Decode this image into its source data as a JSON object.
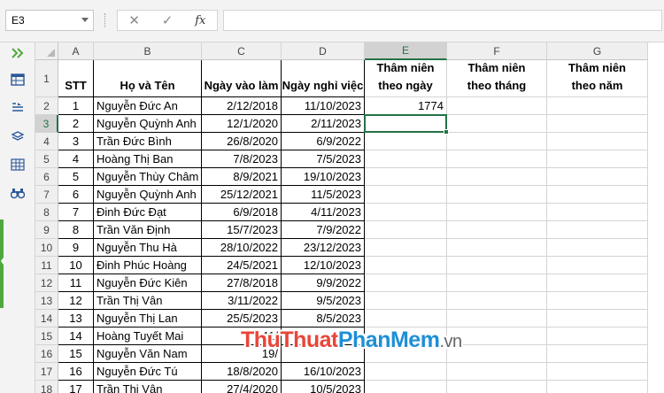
{
  "formula_bar": {
    "name_box": "E3",
    "cancel_glyph": "✕",
    "enter_glyph": "✓",
    "fx_label": "fx",
    "formula": ""
  },
  "sidebar": {
    "icons": [
      "expand-icon",
      "table-icon",
      "list-icon",
      "layers-icon",
      "grid-icon",
      "binoculars-icon"
    ]
  },
  "columns": [
    "A",
    "B",
    "C",
    "D",
    "E",
    "F",
    "G"
  ],
  "selected_column": "E",
  "selected_cell": "E3",
  "headers": {
    "stt": "STT",
    "name": "Họ và Tên",
    "start": "Ngày vào làm",
    "end": "Ngày nghỉ việc",
    "days_l1": "Thâm niên",
    "days_l2": "theo ngày",
    "months_l1": "Thâm niên",
    "months_l2": "theo tháng",
    "years_l1": "Thâm niên",
    "years_l2": "theo năm"
  },
  "row_numbers": [
    "1",
    "2",
    "3",
    "4",
    "5",
    "6",
    "7",
    "8",
    "9",
    "10",
    "11",
    "12",
    "13",
    "14",
    "15",
    "16",
    "17",
    "18"
  ],
  "rows": [
    {
      "stt": "1",
      "name": "Nguyễn Đức An",
      "start": "2/12/2018",
      "end": "11/10/2023",
      "days": "1774"
    },
    {
      "stt": "2",
      "name": "Nguyễn Quỳnh Anh",
      "start": "12/1/2020",
      "end": "2/11/2023",
      "days": ""
    },
    {
      "stt": "3",
      "name": "Trần Đức Bình",
      "start": "26/8/2020",
      "end": "6/9/2022",
      "days": ""
    },
    {
      "stt": "4",
      "name": "Hoàng Thị Ban",
      "start": "7/8/2023",
      "end": "7/5/2023",
      "days": ""
    },
    {
      "stt": "5",
      "name": "Nguyễn Thùy Châm",
      "start": "8/9/2021",
      "end": "19/10/2023",
      "days": ""
    },
    {
      "stt": "6",
      "name": "Nguyễn Quỳnh Anh",
      "start": "25/12/2021",
      "end": "11/5/2023",
      "days": ""
    },
    {
      "stt": "7",
      "name": "Đinh Đức Đạt",
      "start": "6/9/2018",
      "end": "4/11/2023",
      "days": ""
    },
    {
      "stt": "8",
      "name": "Trần Văn Định",
      "start": "15/7/2023",
      "end": "7/9/2022",
      "days": ""
    },
    {
      "stt": "9",
      "name": "Nguyễn Thu Hà",
      "start": "28/10/2022",
      "end": "23/12/2023",
      "days": ""
    },
    {
      "stt": "10",
      "name": "Đinh Phúc Hoàng",
      "start": "24/5/2021",
      "end": "12/10/2023",
      "days": ""
    },
    {
      "stt": "11",
      "name": "Nguyễn Đức Kiên",
      "start": "27/8/2018",
      "end": "9/9/2022",
      "days": ""
    },
    {
      "stt": "12",
      "name": "Trần Thị Vân",
      "start": "3/11/2022",
      "end": "9/5/2023",
      "days": ""
    },
    {
      "stt": "13",
      "name": "Nguyễn Thị Lan",
      "start": "25/5/2023",
      "end": "8/5/2023",
      "days": ""
    },
    {
      "stt": "14",
      "name": "Hoàng Tuyết Mai",
      "start": "11/",
      "end": "",
      "days": ""
    },
    {
      "stt": "15",
      "name": "Nguyễn Văn Nam",
      "start": "19/",
      "end": "",
      "days": ""
    },
    {
      "stt": "16",
      "name": "Nguyễn Đức Tú",
      "start": "18/8/2020",
      "end": "16/10/2023",
      "days": ""
    },
    {
      "stt": "17",
      "name": "Trần Thị Vân",
      "start": "27/4/2020",
      "end": "10/5/2023",
      "days": ""
    }
  ],
  "watermark": {
    "part1": "ThuThuat",
    "part2": "PhanMem",
    "part3": ".vn"
  },
  "colors": {
    "accent_green": "#217346",
    "sidebar_icon": "#2b579a",
    "watermark_red": "#e8463a",
    "watermark_blue": "#1e8fd6"
  }
}
